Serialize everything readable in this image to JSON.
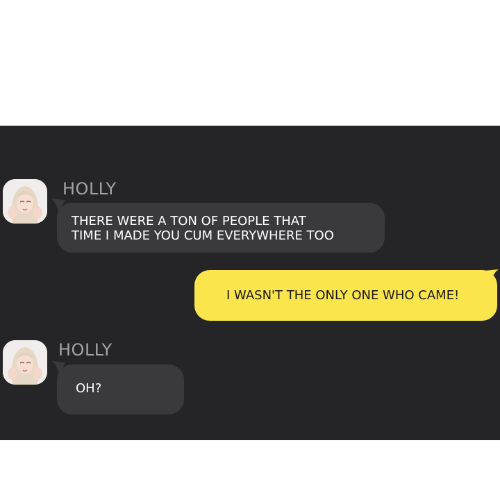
{
  "colors": {
    "panel_bg": "#252527",
    "incoming_bubble": "#3a3a3d",
    "outgoing_bubble": "#fbe54d",
    "name_text": "#a3a3a6"
  },
  "messages": [
    {
      "sender": "HOLLY",
      "direction": "incoming",
      "avatar_icon": "holly-avatar",
      "lines": [
        "THERE WERE A TON OF PEOPLE THAT",
        "TIME I MADE YOU CUM EVERYWHERE TOO"
      ]
    },
    {
      "direction": "outgoing",
      "lines": [
        "I WASN'T THE ONLY ONE WHO CAME!"
      ]
    },
    {
      "sender": "HOLLY",
      "direction": "incoming",
      "avatar_icon": "holly-avatar",
      "lines": [
        "OH?"
      ]
    }
  ]
}
